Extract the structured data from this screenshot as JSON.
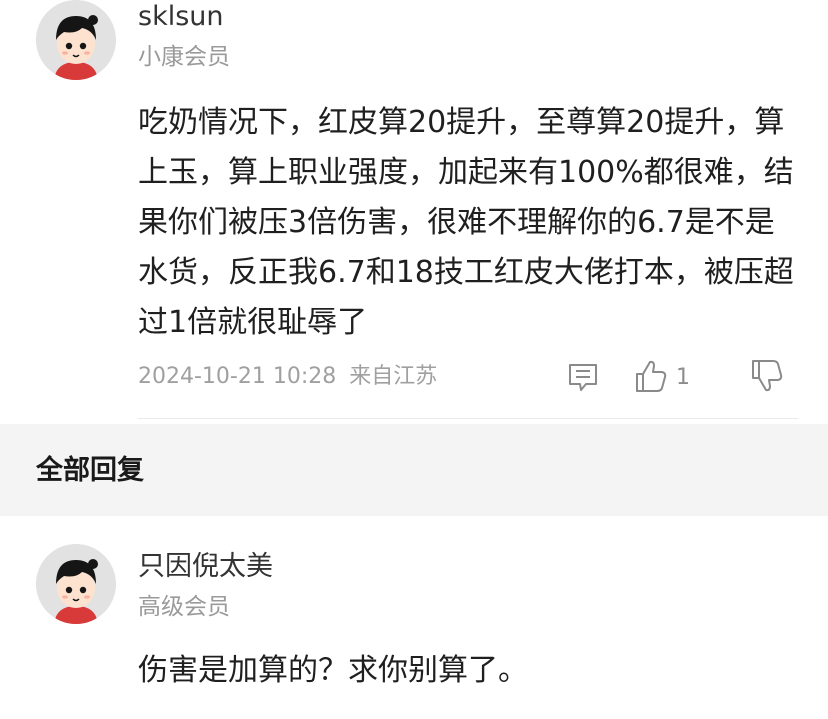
{
  "comment": {
    "username": "sklsun",
    "level": "小康会员",
    "content": "吃奶情况下，红皮算20提升，至尊算20提升，算上玉，算上职业强度，加起来有100%都很难，结果你们被压3倍伤害，很难不理解你的6.7是不是水货，反正我6.7和18技工红皮大佬打本，被压超过1倍就很耻辱了",
    "timestamp": "2024-10-21 10:28",
    "location": "来自江苏",
    "like_count": "1",
    "icons": {
      "reply": "comment-icon",
      "like": "thumbs-up-icon",
      "dislike": "thumbs-down-icon"
    }
  },
  "section": {
    "title": "全部回复"
  },
  "reply": {
    "username": "只因倪太美",
    "level": "高级会员",
    "content": "伤害是加算的？求你别算了。"
  },
  "colors": {
    "section_background": "#f4f4f4",
    "secondary_text": "#9a9a9a",
    "avatar_shirt": "#d83a3a"
  }
}
